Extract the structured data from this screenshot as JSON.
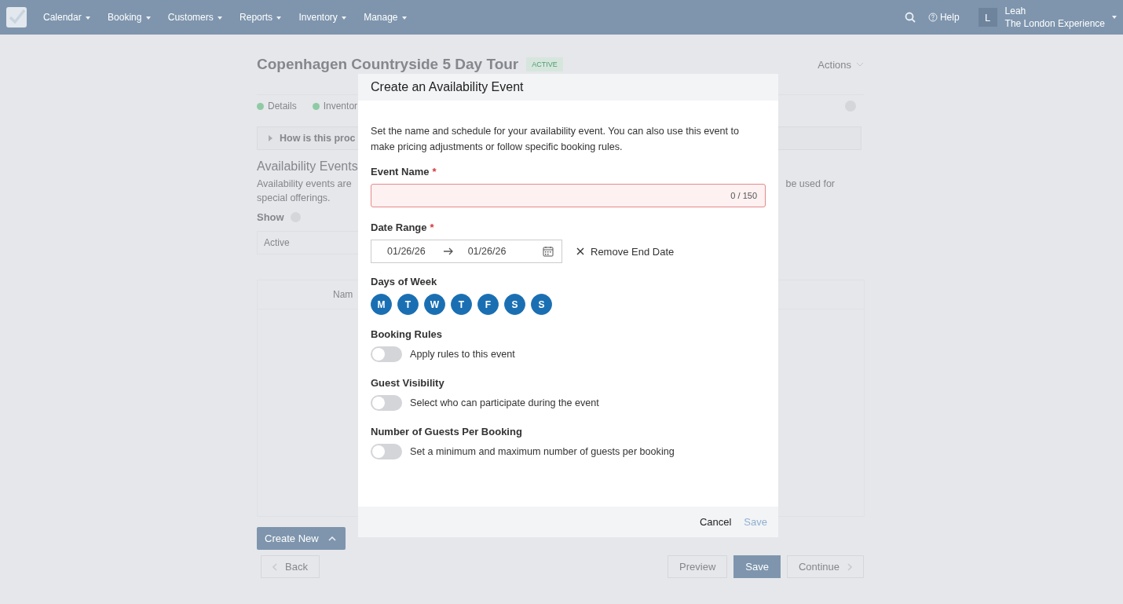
{
  "nav": {
    "menus": [
      "Calendar",
      "Booking",
      "Customers",
      "Reports",
      "Inventory",
      "Manage"
    ],
    "help": "Help",
    "user": {
      "initial": "L",
      "name": "Leah",
      "company": "The London Experience"
    }
  },
  "page": {
    "title": "Copenhagen Countryside 5 Day Tour",
    "status": "ACTIVE",
    "actions": "Actions",
    "steps": [
      {
        "label": "Details",
        "done": true
      },
      {
        "label": "Inventor",
        "done": true
      }
    ],
    "how_text": "How is this proc",
    "section_title": "Availability Events",
    "section_desc_left": "Availability events are",
    "section_desc_right": "be used for",
    "section_desc_line2": "special offerings.",
    "show_label": "Show",
    "filter_value": "Active",
    "table_column": "Nam",
    "create_button": "Create New",
    "back": "Back",
    "preview": "Preview",
    "save": "Save",
    "continue": "Continue"
  },
  "modal": {
    "title": "Create an Availability Event",
    "intro": "Set the name and schedule for your availability event. You can also use this event to make pricing adjustments or follow specific booking rules.",
    "event_name": {
      "label": "Event Name",
      "required": "*",
      "counter": "0 / 150",
      "invalid": true
    },
    "date_range": {
      "label": "Date Range",
      "required": "*",
      "start": "01/26/26",
      "end": "01/26/26",
      "remove": "Remove End Date"
    },
    "days_label": "Days of Week",
    "days": [
      {
        "label": "M",
        "selected": true
      },
      {
        "label": "T",
        "selected": true
      },
      {
        "label": "W",
        "selected": true
      },
      {
        "label": "T",
        "selected": true
      },
      {
        "label": "F",
        "selected": true
      },
      {
        "label": "S",
        "selected": true
      },
      {
        "label": "S",
        "selected": true
      }
    ],
    "toggles": [
      {
        "heading": "Booking Rules",
        "label": "Apply rules to this event",
        "on": false
      },
      {
        "heading": "Guest Visibility",
        "label": "Select who can participate during the event",
        "on": false
      },
      {
        "heading": "Number of Guests Per Booking",
        "label": "Set a minimum and maximum number of guests per booking",
        "on": false
      }
    ],
    "cancel": "Cancel",
    "save": "Save",
    "save_disabled": true
  }
}
